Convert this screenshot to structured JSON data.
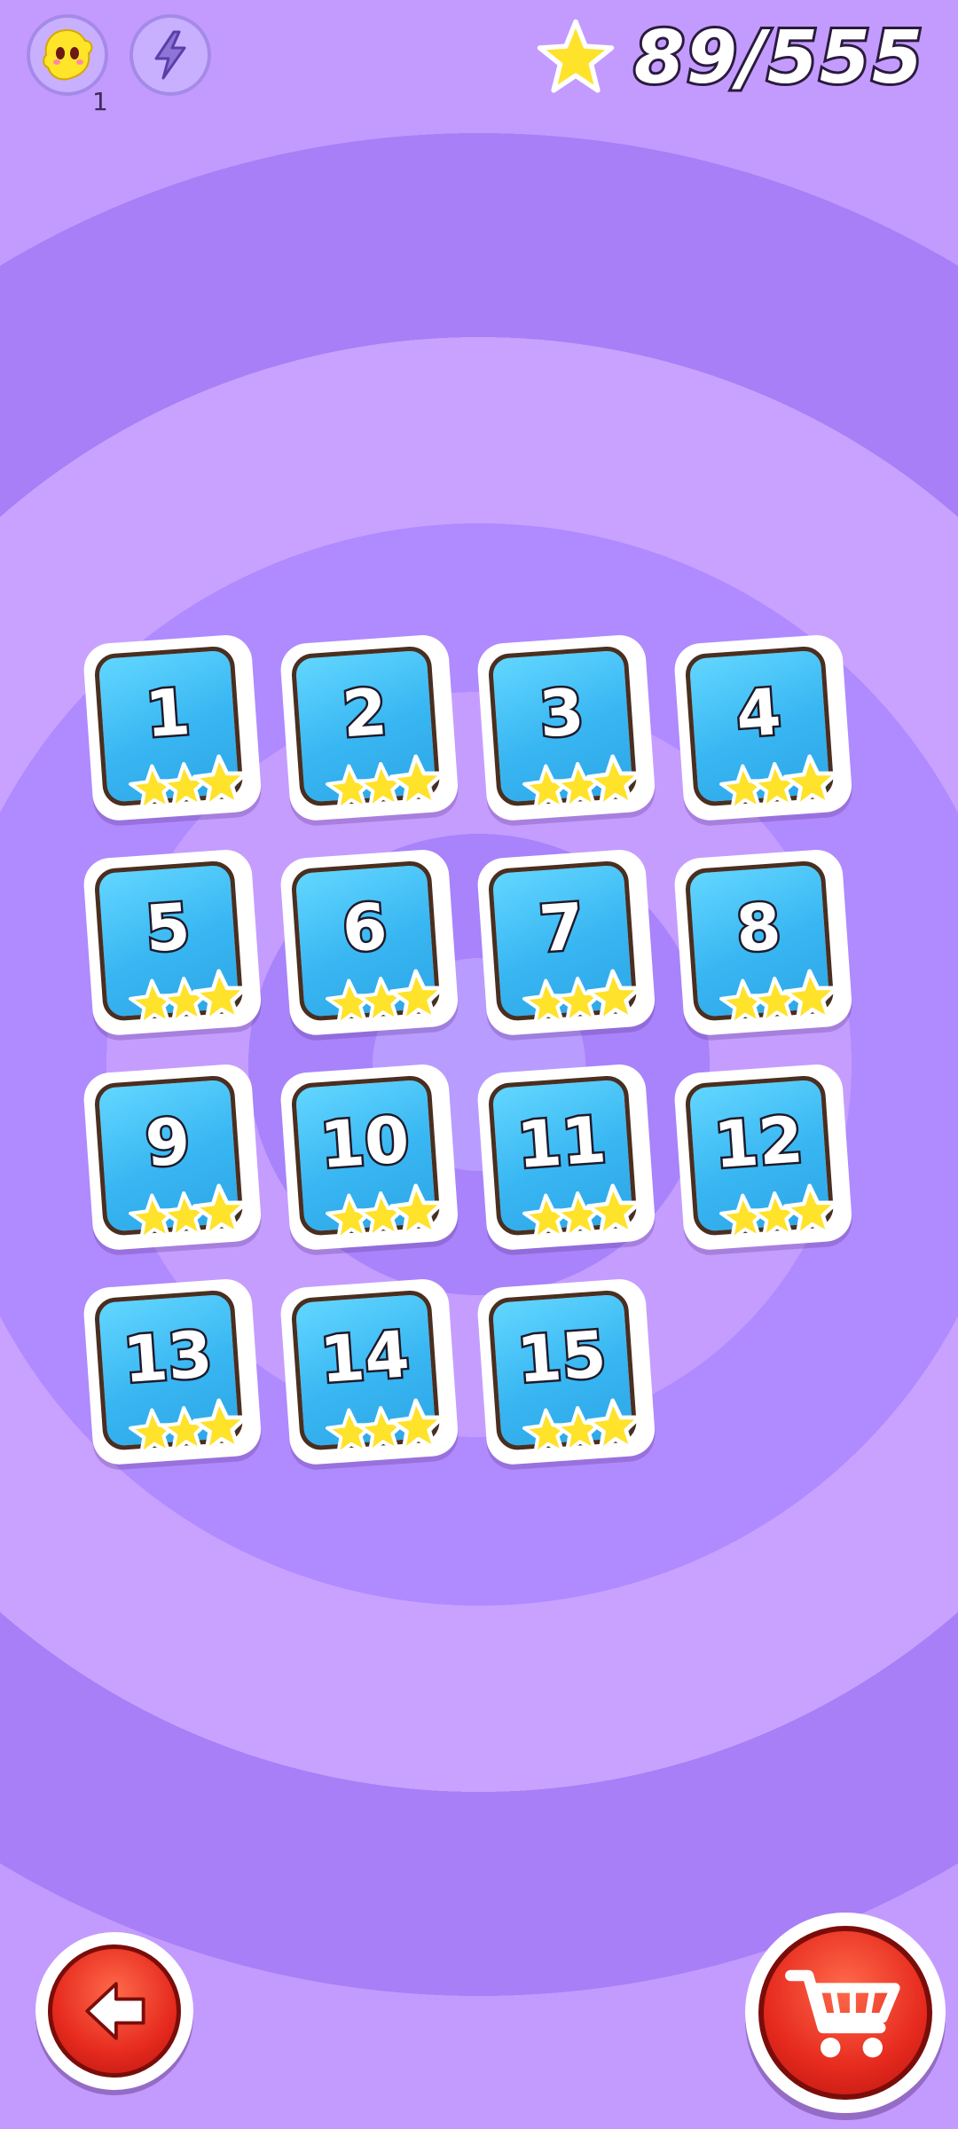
{
  "hud": {
    "boost_count": "1",
    "stars_collected": "89/555"
  },
  "levels": [
    {
      "number": "1",
      "stars": 3
    },
    {
      "number": "2",
      "stars": 3
    },
    {
      "number": "3",
      "stars": 3
    },
    {
      "number": "4",
      "stars": 3
    },
    {
      "number": "5",
      "stars": 3
    },
    {
      "number": "6",
      "stars": 3
    },
    {
      "number": "7",
      "stars": 3
    },
    {
      "number": "8",
      "stars": 3
    },
    {
      "number": "9",
      "stars": 3
    },
    {
      "number": "10",
      "stars": 3
    },
    {
      "number": "11",
      "stars": 3
    },
    {
      "number": "12",
      "stars": 3
    },
    {
      "number": "13",
      "stars": 3
    },
    {
      "number": "14",
      "stars": 3
    },
    {
      "number": "15",
      "stars": 3
    }
  ],
  "icons": {
    "boost": "yellow-creature-icon",
    "energy": "lightning-icon",
    "stars": "star-icon",
    "back": "arrow-left-icon",
    "shop": "shopping-cart-icon"
  },
  "colors": {
    "background": "#b08aff",
    "card": "#38b6f2",
    "star": "#ffe22a",
    "button_red": "#e62a1e"
  }
}
